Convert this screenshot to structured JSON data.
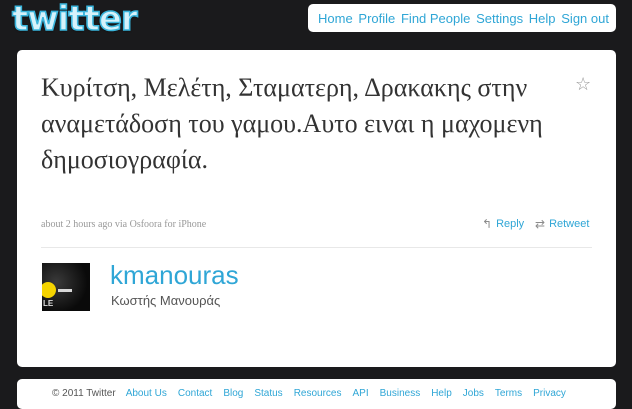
{
  "header": {
    "logo_text": "twitter",
    "nav": [
      "Home",
      "Profile",
      "Find People",
      "Settings",
      "Help",
      "Sign out"
    ]
  },
  "tweet": {
    "text": "Κυρίτση, Μελέτη, Σταματερη, Δρακακης στην αναμετάδοση του γαμου.Αυτο ειναι η μαχομενη δημοσιογραφία.",
    "meta": "about 2 hours ago via Osfoora for iPhone",
    "reply_label": "Reply",
    "retweet_label": "Retweet",
    "favorite_icon": "star-icon",
    "reply_icon": "reply-arrow-icon",
    "retweet_icon": "retweet-icon"
  },
  "author": {
    "screen_name": "kmanouras",
    "full_name": "Κωστής Μανουράς"
  },
  "footer": {
    "copyright": "© 2011 Twitter",
    "links": [
      "About Us",
      "Contact",
      "Blog",
      "Status",
      "Resources",
      "API",
      "Business",
      "Help",
      "Jobs",
      "Terms",
      "Privacy"
    ]
  },
  "colors": {
    "background": "#1a1a1c",
    "link": "#2fa6d6",
    "text": "#333333",
    "muted": "#999999"
  }
}
